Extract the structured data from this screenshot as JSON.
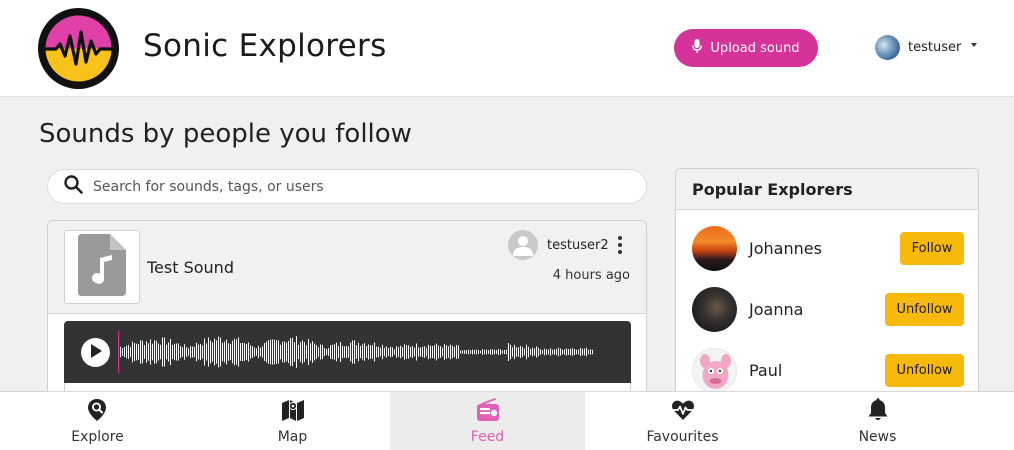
{
  "app": {
    "title": "Sonic Explorers"
  },
  "header": {
    "upload_label": "Upload sound",
    "username": "testuser"
  },
  "page": {
    "heading": "Sounds by people you follow"
  },
  "search": {
    "placeholder": "Search for sounds, tags, or users"
  },
  "feed": [
    {
      "title": "Test Sound",
      "author": "testuser2",
      "time": "4 hours ago"
    }
  ],
  "popular": {
    "title": "Popular Explorers",
    "explorers": [
      {
        "name": "Johannes",
        "action": "Follow"
      },
      {
        "name": "Joanna",
        "action": "Unfollow"
      },
      {
        "name": "Paul",
        "action": "Unfollow"
      }
    ]
  },
  "nav": [
    {
      "label": "Explore",
      "icon": "map-pin-search-icon",
      "active": false
    },
    {
      "label": "Map",
      "icon": "map-icon",
      "active": false
    },
    {
      "label": "Feed",
      "icon": "radio-icon",
      "active": true
    },
    {
      "label": "Favourites",
      "icon": "heartbeat-icon",
      "active": false
    },
    {
      "label": "News",
      "icon": "bell-icon",
      "active": false
    }
  ],
  "colors": {
    "accent": "#d6339a",
    "follow_button": "#f7b90a",
    "active_nav": "#e060b4",
    "player_bg": "#333333"
  }
}
